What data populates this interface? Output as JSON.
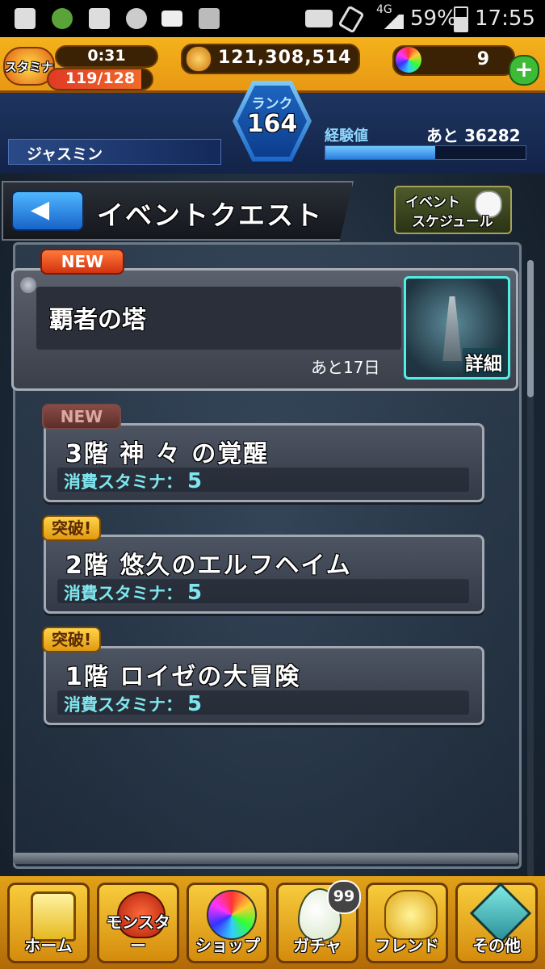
{
  "status_bar": {
    "network": "4G",
    "battery": "59%",
    "time": "17:55"
  },
  "header": {
    "stamina_label": "スタミナ",
    "stamina_timer": "0:31",
    "stamina_value": "119/128",
    "coins": "121,308,514",
    "orbs": "9",
    "rank_label": "ランク",
    "rank_value": "164",
    "player_name": "ジャスミン",
    "exp_label": "経験値",
    "exp_remaining": "あと 36282",
    "exp_progress": 0.55
  },
  "title_bar": {
    "title": "イベントクエスト",
    "schedule_line1": "イベント",
    "schedule_line2": "スケジュール"
  },
  "event": {
    "badge": "NEW",
    "name": "覇者の塔",
    "remaining": "あと17日",
    "detail_label": "詳細"
  },
  "quests": [
    {
      "badge": "NEW",
      "title": "3階 神 々 の覚醒",
      "cost_label": "消費スタミナ：",
      "cost": "5"
    },
    {
      "badge": "突破!",
      "title": "2階 悠久のエルフヘイム",
      "cost_label": "消費スタミナ：",
      "cost": "5"
    },
    {
      "badge": "突破!",
      "title": "1階 ロイゼの大冒険",
      "cost_label": "消費スタミナ：",
      "cost": "5"
    }
  ],
  "bottom_nav": {
    "items": [
      {
        "label": "ホーム",
        "icon": "home-icon"
      },
      {
        "label": "モンスター",
        "icon": "monster-icon"
      },
      {
        "label": "ショップ",
        "icon": "orb-icon"
      },
      {
        "label": "ガチャ",
        "icon": "egg-icon",
        "badge": "99"
      },
      {
        "label": "フレンド",
        "icon": "friends-icon"
      },
      {
        "label": "その他",
        "icon": "other-icon"
      }
    ]
  },
  "colors": {
    "header_orange": "#e79512",
    "navy": "#132348",
    "accent_cyan": "#7fe6ef",
    "new_red": "#e8461e",
    "breakthrough_gold": "#f0b020"
  }
}
